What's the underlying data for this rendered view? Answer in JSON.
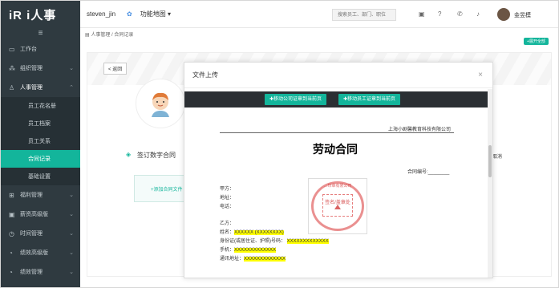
{
  "app": {
    "logo": "iR i人事"
  },
  "sidebar": {
    "collapse_icon": "≡",
    "items": [
      {
        "label": "工作台",
        "icon": "monitor-icon"
      },
      {
        "label": "组织管理",
        "icon": "org-icon"
      },
      {
        "label": "人事管理",
        "icon": "person-icon"
      },
      {
        "label": "福利管理",
        "icon": "gift-icon"
      },
      {
        "label": "薪资高级版",
        "icon": "wallet-icon"
      },
      {
        "label": "时间管理",
        "icon": "clock-icon"
      },
      {
        "label": "绩效高级版",
        "icon": "chart-icon"
      },
      {
        "label": "绩效管理",
        "icon": "chart-icon"
      }
    ],
    "sub_items": [
      "员工花名册",
      "员工档案",
      "员工关系",
      "合同记录",
      "基础设置"
    ],
    "active_sub": "合同记录"
  },
  "topbar": {
    "user": "steven_jin",
    "menu": "功能地图",
    "search_placeholder": "搜索员工、部门、职位",
    "account_name": "金昱模"
  },
  "breadcrumb": "人事管理 / 合同记录",
  "expand_button": "+展开全部",
  "page": {
    "back_label": "返回",
    "sign_title": "签订数字合同",
    "add_contract": "+添加合同文件",
    "cancel_text": "取消"
  },
  "modal": {
    "title": "文件上传",
    "move_company_label": "移动公司证章到当前页",
    "move_employee_label": "移动员工证章到当前页",
    "document": {
      "company": "上海小剧馨教育科技有限公司",
      "title": "劳动合同",
      "contract_no": "合同编号:________",
      "party_a": "甲方：",
      "address": "地址：",
      "phone": "电话：",
      "party_b": "乙方：",
      "name_label": "姓名：",
      "name_value": "XXXXXX (XXXXXXXX)",
      "id_label": "身份证(或居住证、护照)号码：",
      "id_value": "XXXXXXXXXXXXX",
      "mobile_label": "手机：",
      "mobile_value": "XXXXXXXXXXXXX",
      "mail_label": "通讯地址：",
      "mail_value": "XXXXXXXXXXXXX",
      "stamp_label": "签名/盖章处",
      "stamp_ring_text": "…印章有限公司"
    }
  }
}
